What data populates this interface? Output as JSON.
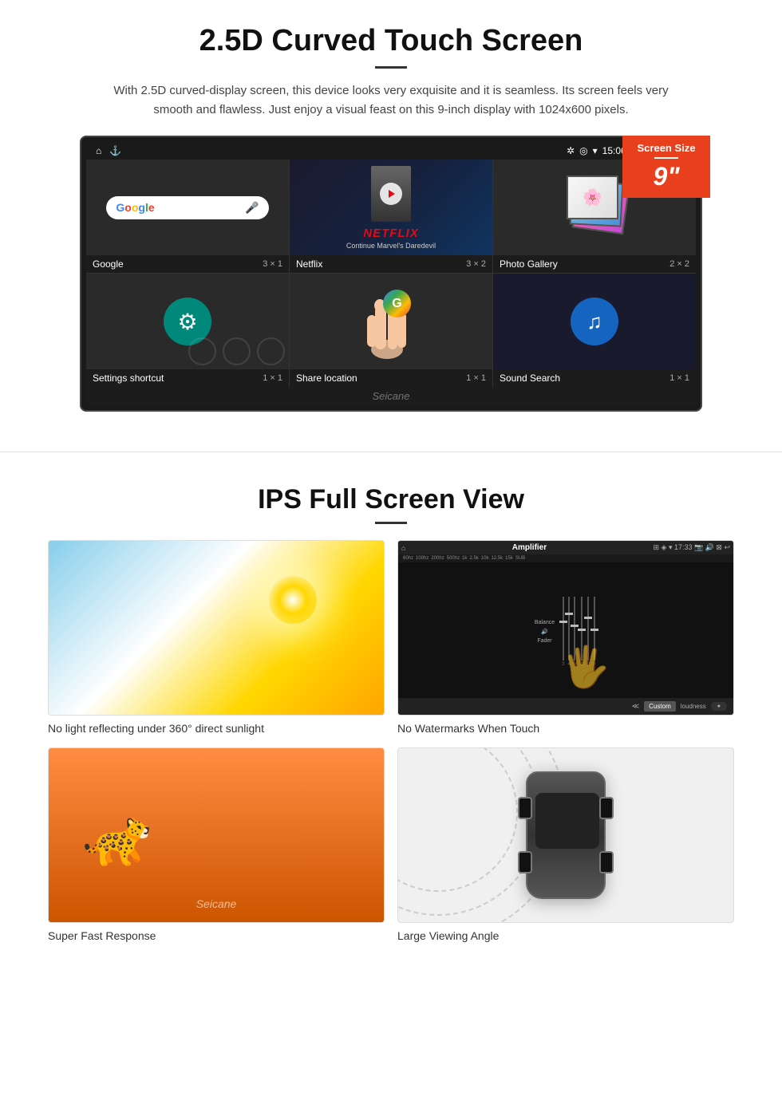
{
  "section1": {
    "title": "2.5D Curved Touch Screen",
    "description": "With 2.5D curved-display screen, this device looks very exquisite and it is seamless. Its screen feels very smooth and flawless. Just enjoy a visual feast on this 9-inch display with 1024x600 pixels.",
    "badge": {
      "label": "Screen Size",
      "size": "9\""
    },
    "status_bar": {
      "time": "15:06"
    },
    "apps": [
      {
        "name": "Google",
        "size": "3 × 1"
      },
      {
        "name": "Netflix",
        "size": "3 × 2",
        "sub": "Continue Marvel's Daredevil"
      },
      {
        "name": "Photo Gallery",
        "size": "2 × 2"
      },
      {
        "name": "Settings shortcut",
        "size": "1 × 1"
      },
      {
        "name": "Share location",
        "size": "1 × 1"
      },
      {
        "name": "Sound Search",
        "size": "1 × 1"
      }
    ],
    "watermark": "Seicane"
  },
  "section2": {
    "title": "IPS Full Screen View",
    "cards": [
      {
        "id": "sunlight",
        "caption": "No light reflecting under 360° direct sunlight"
      },
      {
        "id": "amplifier",
        "caption": "No Watermarks When Touch",
        "header": "Amplifier",
        "footer_custom": "Custom",
        "footer_loudness": "loudness"
      },
      {
        "id": "cheetah",
        "caption": "Super Fast Response",
        "watermark": "Seicane"
      },
      {
        "id": "car",
        "caption": "Large Viewing Angle"
      }
    ]
  }
}
